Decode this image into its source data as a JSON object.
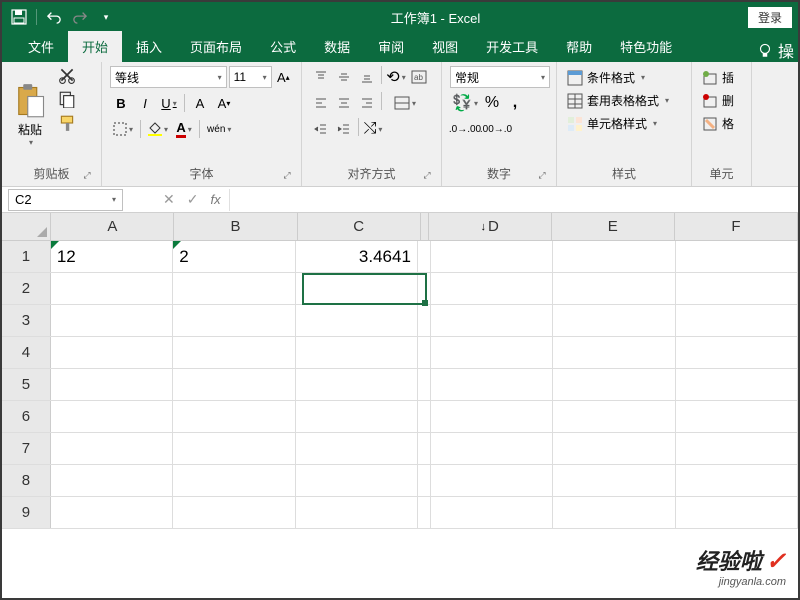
{
  "titlebar": {
    "title": "工作簿1 - Excel",
    "login": "登录"
  },
  "tabs": {
    "file": "文件",
    "home": "开始",
    "insert": "插入",
    "pagelayout": "页面布局",
    "formulas": "公式",
    "data": "数据",
    "review": "审阅",
    "view": "视图",
    "developer": "开发工具",
    "help": "帮助",
    "special": "特色功能",
    "tellme": "操"
  },
  "ribbon": {
    "clipboard": {
      "paste": "粘贴",
      "label": "剪贴板"
    },
    "font": {
      "name": "等线",
      "size": "11",
      "bold": "B",
      "italic": "I",
      "underline": "U",
      "label": "字体",
      "pinyin": "wén"
    },
    "alignment": {
      "label": "对齐方式"
    },
    "number": {
      "format": "常规",
      "label": "数字"
    },
    "styles": {
      "conditional": "条件格式",
      "table": "套用表格格式",
      "cell": "单元格样式",
      "label": "样式"
    },
    "cells": {
      "insert": "插",
      "delete": "删",
      "format": "格",
      "label": "单元"
    }
  },
  "namebox": {
    "value": "C2",
    "fx": "fx"
  },
  "columns": [
    "A",
    "B",
    "C",
    "D",
    "E",
    "F"
  ],
  "rows": [
    "1",
    "2",
    "3",
    "4",
    "5",
    "6",
    "7",
    "8",
    "9"
  ],
  "cells": {
    "A1": "12",
    "B1": "2",
    "C1": "3.4641"
  },
  "watermark": {
    "main": "经验啦",
    "sub": "jingyanla.com"
  }
}
